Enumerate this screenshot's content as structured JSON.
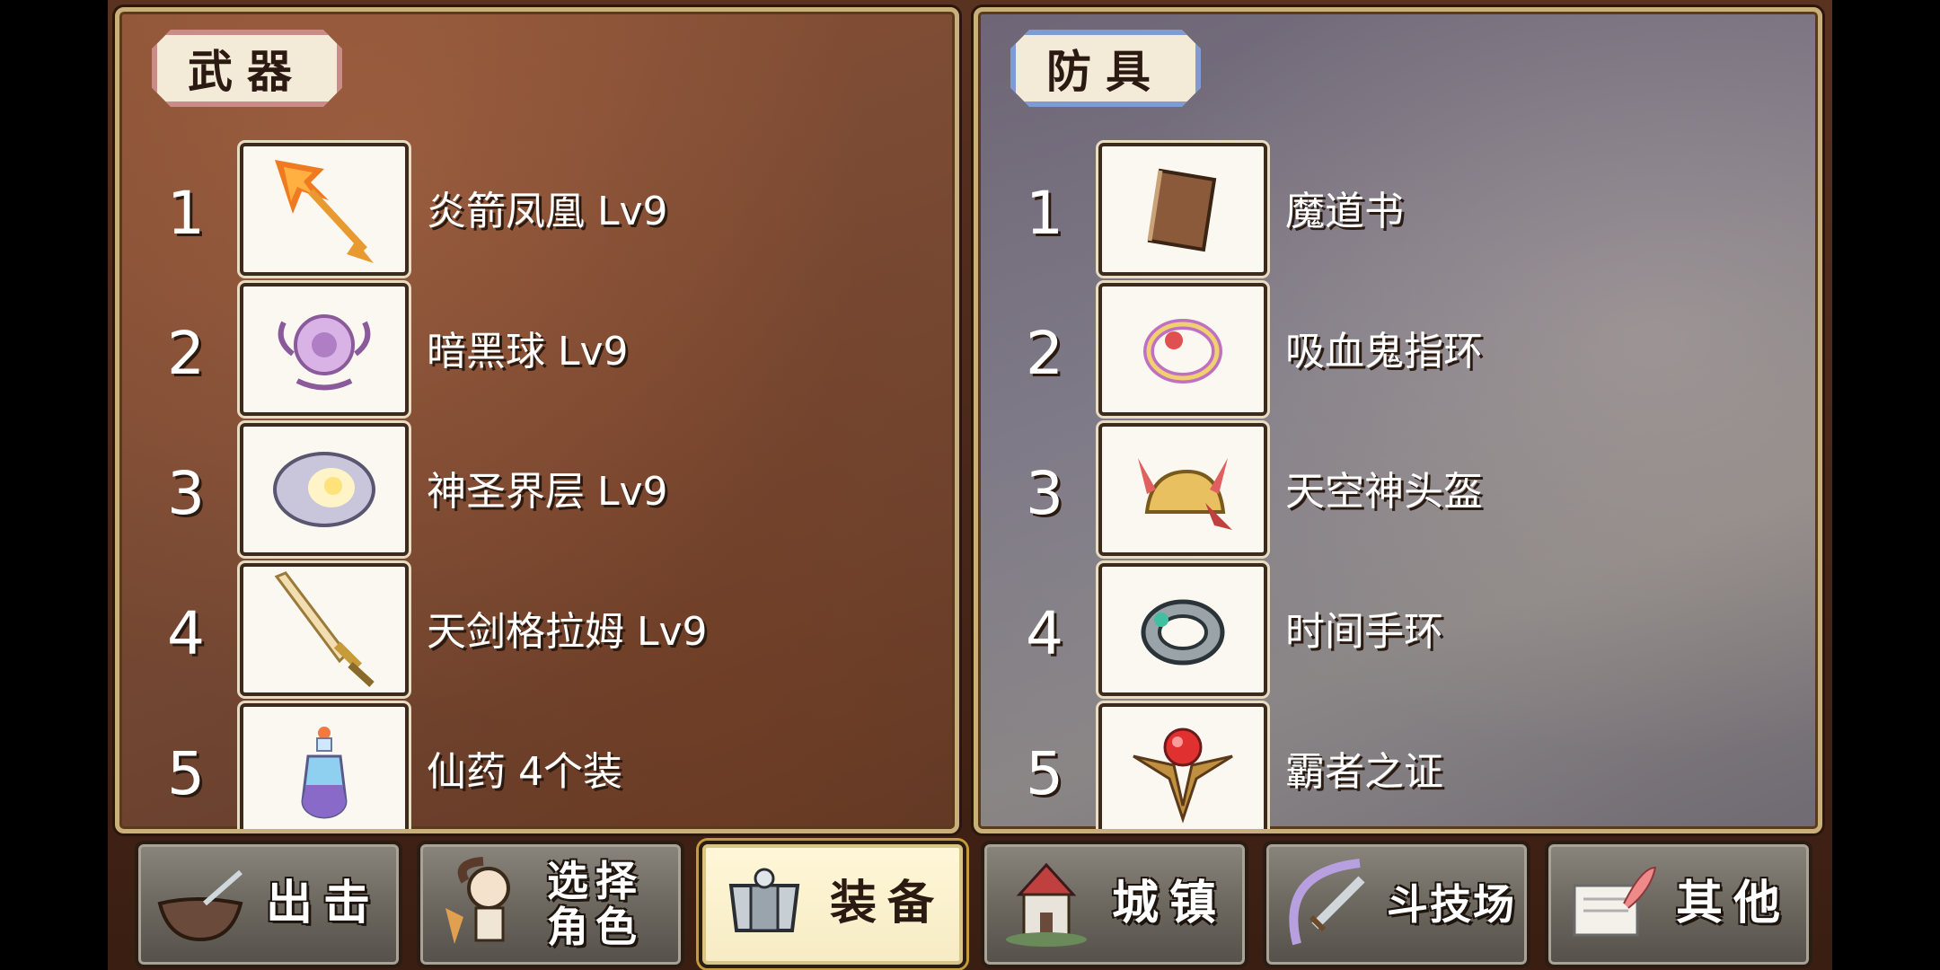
{
  "weapons": {
    "title": "武器",
    "items": [
      {
        "num": "1",
        "name": "炎箭凤凰 Lv9",
        "icon": "flame-arrow-icon"
      },
      {
        "num": "2",
        "name": "暗黑球 Lv9",
        "icon": "dark-orb-icon"
      },
      {
        "num": "3",
        "name": "神圣界层 Lv9",
        "icon": "holy-barrier-icon"
      },
      {
        "num": "4",
        "name": "天剑格拉姆 Lv9",
        "icon": "sword-icon"
      },
      {
        "num": "5",
        "name": "仙药 4个装",
        "icon": "potion-icon"
      }
    ]
  },
  "armor": {
    "title": "防具",
    "items": [
      {
        "num": "1",
        "name": "魔道书",
        "icon": "spellbook-icon"
      },
      {
        "num": "2",
        "name": "吸血鬼指环",
        "icon": "vampire-ring-icon"
      },
      {
        "num": "3",
        "name": "天空神头盔",
        "icon": "winged-helmet-icon"
      },
      {
        "num": "4",
        "name": "时间手环",
        "icon": "time-bracelet-icon"
      },
      {
        "num": "5",
        "name": "霸者之证",
        "icon": "emblem-icon"
      }
    ]
  },
  "nav": [
    {
      "label": "出击",
      "icon": "sortie-icon"
    },
    {
      "label": "选择角色",
      "icon": "character-icon"
    },
    {
      "label": "装备",
      "icon": "armor-icon",
      "active": true
    },
    {
      "label": "城镇",
      "icon": "town-icon"
    },
    {
      "label": "斗技场",
      "icon": "arena-icon"
    },
    {
      "label": "其他",
      "icon": "scroll-icon"
    }
  ],
  "colors": {
    "weapons_accent": "#c98c88",
    "armor_accent": "#7f9bd3",
    "active_button": "#f6ebc4"
  }
}
